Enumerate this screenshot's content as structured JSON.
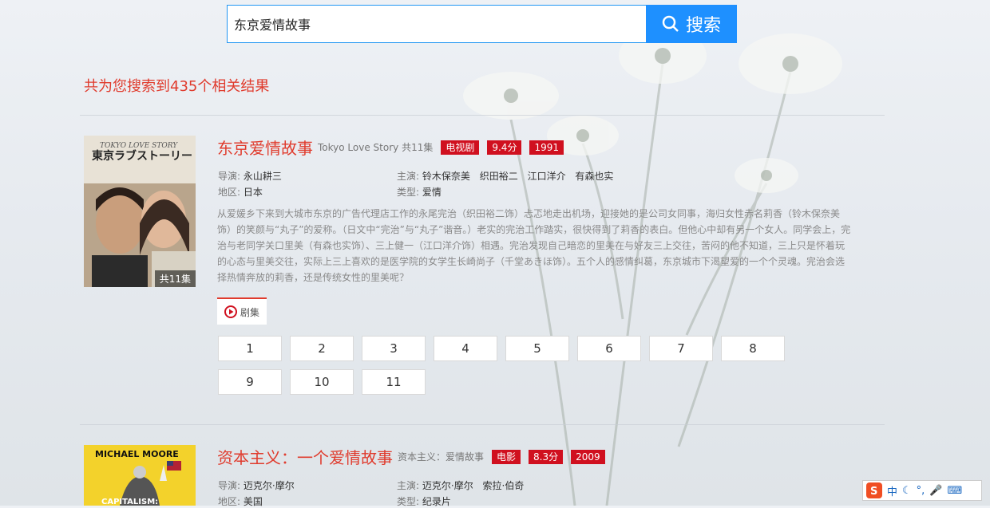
{
  "search": {
    "query": "东京爱情故事",
    "button_label": "搜索"
  },
  "result_count": "共为您搜索到435个相关结果",
  "results": [
    {
      "title": "东京爱情故事",
      "original_title": "Tokyo Love Story",
      "episodes_total": "共11集",
      "tags": [
        "电视剧",
        "9.4分",
        "1991"
      ],
      "director_label": "导演:",
      "director": "永山耕三",
      "cast_label": "主演:",
      "cast": [
        "铃木保奈美",
        "织田裕二",
        "江口洋介",
        "有森也实"
      ],
      "region_label": "地区:",
      "region": "日本",
      "genre_label": "类型:",
      "genre": "爱情",
      "poster_badge": "共11集",
      "description": "从爱媛乡下来到大城市东京的广告代理店工作的永尾完治（织田裕二饰）忐忑地走出机场，迎接她的是公司女同事，海归女性赤名莉香（铃木保奈美饰）的笑颜与“丸子”的爱称。（日文中“完治”与“丸子”谐音。）老实的完治工作踏实，很快得到了莉香的表白。但他心中却有另一个女人。同学会上，完治与老同学关口里美（有森也实饰）、三上健一（江口洋介饰）相遇。完治发现自己暗恋的里美在与好友三上交往，苦闷的他不知道，三上只是怀着玩的心态与里美交往，实际上三上喜欢的是医学院的女学生长崎尚子（千堂あきほ饰）。五个人的感情纠葛，东京城市下渴望爱的一个个灵魂。完治会选择热情奔放的莉香，还是传统女性的里美呢？",
      "tab_label": "剧集",
      "episodes": [
        "1",
        "2",
        "3",
        "4",
        "5",
        "6",
        "7",
        "8",
        "9",
        "10",
        "11"
      ]
    },
    {
      "title": "资本主义：一个爱情故事",
      "original_title": "资本主义：爱情故事",
      "tags": [
        "电影",
        "8.3分",
        "2009"
      ],
      "director_label": "导演:",
      "director": "迈克尔·摩尔",
      "cast_label": "主演:",
      "cast": [
        "迈克尔·摩尔",
        "索拉·伯奇"
      ],
      "region_label": "地区:",
      "region": "美国",
      "genre_label": "类型:",
      "genre": "纪录片",
      "poster_text_top": "MICHAEL MOORE",
      "poster_text_bottom": "CAPITALISM:"
    }
  ],
  "ime": {
    "label": "中"
  }
}
